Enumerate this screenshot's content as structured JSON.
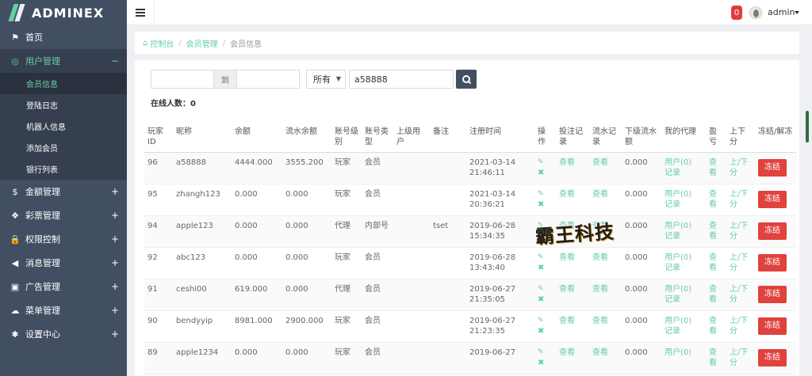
{
  "brand": {
    "name": "ADMINEX"
  },
  "sidebar": {
    "items": [
      {
        "label": "首页",
        "icon": "flag-icon",
        "glyph": "⚑"
      },
      {
        "label": "用户管理",
        "icon": "palette-icon",
        "glyph": "◎",
        "expanded": "−",
        "children": [
          "会员信息",
          "登陆日志",
          "机器人信息",
          "添加会员",
          "银行列表"
        ]
      },
      {
        "label": "金额管理",
        "icon": "dollar-icon",
        "glyph": "$",
        "expanded": "+"
      },
      {
        "label": "彩票管理",
        "icon": "gift-icon",
        "glyph": "❖",
        "expanded": "+"
      },
      {
        "label": "权限控制",
        "icon": "lock-icon",
        "glyph": "🔒",
        "expanded": "+"
      },
      {
        "label": "消息管理",
        "icon": "bullhorn-icon",
        "glyph": "◀",
        "expanded": "+"
      },
      {
        "label": "广告管理",
        "icon": "image-icon",
        "glyph": "▣",
        "expanded": "+"
      },
      {
        "label": "菜单管理",
        "icon": "cloud-icon",
        "glyph": "☁",
        "expanded": "+"
      },
      {
        "label": "设置中心",
        "icon": "gear-icon",
        "glyph": "✱",
        "expanded": "+"
      }
    ]
  },
  "header": {
    "notification_count": "0",
    "user": "admin"
  },
  "breadcrumb": [
    "控制台",
    "会员管理",
    "会员信息"
  ],
  "search": {
    "range_sep": "到",
    "type_selected": "所有",
    "keyword": "a58888",
    "online_label": "在线人数：",
    "online_count": "0"
  },
  "table": {
    "headers": [
      "玩家ID",
      "昵称",
      "余额",
      "流水余额",
      "账号级别",
      "账号类型",
      "上级用户",
      "备注",
      "注册时间",
      "操作",
      "投注记录",
      "流水记录",
      "下级流水额",
      "我的代理",
      "盈亏",
      "上下分",
      "冻结/解冻"
    ],
    "rows": [
      {
        "id": "96",
        "nick": "a58888",
        "balance": "4444.000",
        "flow": "3555.200",
        "level": "玩家",
        "type": "会员",
        "parent": "",
        "note": "",
        "date": "2021-03-14",
        "time": "21:46:11",
        "bet": "查看",
        "flow_rec": "查看",
        "sub_flow": "0.000",
        "agent1": "用户(0)",
        "agent2": "记录",
        "pnl": "查看",
        "updown": "上/下分",
        "action": "冻结"
      },
      {
        "id": "95",
        "nick": "zhangh123",
        "balance": "0.000",
        "flow": "0.000",
        "level": "玩家",
        "type": "会员",
        "parent": "",
        "note": "",
        "date": "2021-03-14",
        "time": "20:36:21",
        "bet": "查看",
        "flow_rec": "查看",
        "sub_flow": "0.000",
        "agent1": "用户(0)",
        "agent2": "记录",
        "pnl": "查看",
        "updown": "上/下分",
        "action": "冻结"
      },
      {
        "id": "94",
        "nick": "apple123",
        "balance": "0.000",
        "flow": "0.000",
        "level": "代理",
        "type": "内部号",
        "parent": "",
        "note": "tset",
        "date": "2019-06-28",
        "time": "15:34:35",
        "bet": "查看",
        "flow_rec": "查看",
        "sub_flow": "0.000",
        "agent1": "用户(0)",
        "agent2": "记录",
        "pnl": "查看",
        "updown": "上/下分",
        "action": "冻结"
      },
      {
        "id": "92",
        "nick": "abc123",
        "balance": "0.000",
        "flow": "0.000",
        "level": "玩家",
        "type": "会员",
        "parent": "",
        "note": "",
        "date": "2019-06-28",
        "time": "13:43:40",
        "bet": "查看",
        "flow_rec": "查看",
        "sub_flow": "0.000",
        "agent1": "用户(0)",
        "agent2": "记录",
        "pnl": "查看",
        "updown": "上/下分",
        "action": "冻结"
      },
      {
        "id": "91",
        "nick": "ceshi00",
        "balance": "619.000",
        "flow": "0.000",
        "level": "代理",
        "type": "会员",
        "parent": "",
        "note": "",
        "date": "2019-06-27",
        "time": "21:35:05",
        "bet": "查看",
        "flow_rec": "查看",
        "sub_flow": "0.000",
        "agent1": "用户(0)",
        "agent2": "记录",
        "pnl": "查看",
        "updown": "上/下分",
        "action": "冻结"
      },
      {
        "id": "90",
        "nick": "bendyyip",
        "balance": "8981.000",
        "flow": "2900.000",
        "level": "玩家",
        "type": "会员",
        "parent": "",
        "note": "",
        "date": "2019-06-27",
        "time": "21:23:35",
        "bet": "查看",
        "flow_rec": "查看",
        "sub_flow": "0.000",
        "agent1": "用户(0)",
        "agent2": "记录",
        "pnl": "查看",
        "updown": "上/下分",
        "action": "冻结"
      },
      {
        "id": "89",
        "nick": "apple1234",
        "balance": "0.000",
        "flow": "0.000",
        "level": "玩家",
        "type": "会员",
        "parent": "",
        "note": "",
        "date": "2019-06-27",
        "time": "",
        "bet": "查看",
        "flow_rec": "查看",
        "sub_flow": "0.000",
        "agent1": "用户(0)",
        "agent2": "",
        "pnl": "查看",
        "updown": "上/下分",
        "action": "冻结"
      }
    ]
  },
  "watermark": "霸王科技",
  "colors": {
    "accent": "#65cea7",
    "sidebar": "#424f63",
    "danger": "#e0423e"
  }
}
